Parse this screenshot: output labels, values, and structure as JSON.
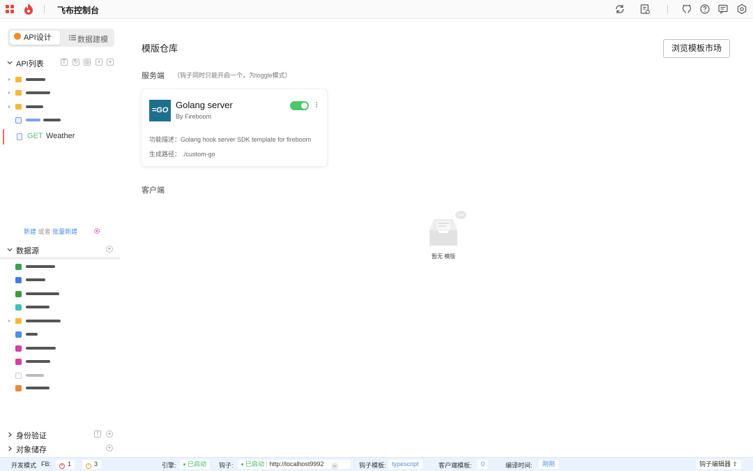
{
  "topbar": {
    "title": "飞布控制台",
    "icons": [
      "apps-grid-icon",
      "fireboom-logo-icon",
      "refresh-icon",
      "document-settings-icon",
      "github-icon",
      "help-icon",
      "message-icon",
      "settings-icon"
    ]
  },
  "sidebar": {
    "tabs": [
      {
        "label": "API设计",
        "active": true
      },
      {
        "label": "数据建模",
        "active": false
      }
    ],
    "api_section": {
      "label": "API列表",
      "buttons": [
        "T",
        "↻",
        "◎",
        "+",
        "+"
      ],
      "selected_item": {
        "method": "GET",
        "name": "Weather"
      },
      "new_link": "新建",
      "or_text": "或者",
      "batch_link": "批量新建"
    },
    "datasource_section": {
      "label": "数据源"
    },
    "auth_section": {
      "label": "身份验证"
    },
    "storage_section": {
      "label": "对象储存"
    }
  },
  "main": {
    "title": "模版仓库",
    "browse_button": "浏览模板市场",
    "server_label": "服务端",
    "server_hint": "（钩子同时只能开启一个，为toggle模式）",
    "card": {
      "logo_text": "=GO",
      "title": "Golang server",
      "author": "By Fireboom",
      "enabled": true,
      "description": "功能描述：Golang hook server SDK template for fireboom",
      "path": "生成路径：  ./custom-go"
    },
    "client_label": "客户端",
    "empty_text": "暂无 模版"
  },
  "statusbar": {
    "mode": "开发模式",
    "fb_label": "FB:",
    "errors": "1",
    "warnings": "3",
    "engine_label": "引擎:",
    "engine_status": "已启动",
    "hook_label": "钩子:",
    "hook_status": "已启动",
    "hook_url": "http://localhost9992",
    "hook_template_label": "钩子模板:",
    "hook_template_value": "typescript",
    "client_template_label": "客户端模板:",
    "client_template_value": "0",
    "compile_label": "编译时间:",
    "compile_value": "刚刚",
    "hook_editor": "钩子编辑器"
  },
  "colors": {
    "accent": "#4b8ef0",
    "success": "#3fb763",
    "brand_red": "#e0463f",
    "go_blue": "#1e6f8c"
  }
}
